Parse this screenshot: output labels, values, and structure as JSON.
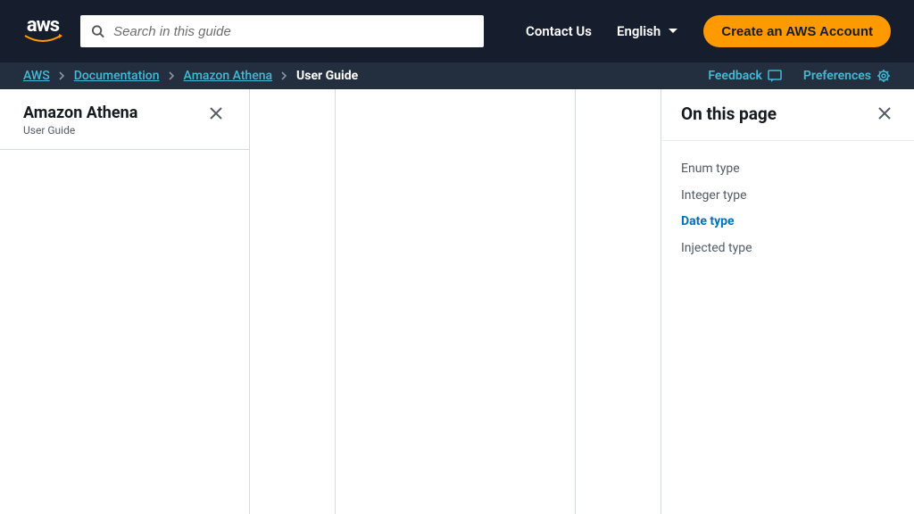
{
  "header": {
    "search_placeholder": "Search in this guide",
    "contact": "Contact Us",
    "language": "English",
    "create": "Create an AWS Account"
  },
  "breadcrumb": {
    "items": [
      "AWS",
      "Documentation",
      "Amazon Athena"
    ],
    "current": "User Guide",
    "feedback": "Feedback",
    "preferences": "Preferences"
  },
  "left": {
    "title": "Amazon Athena",
    "sub": "User Guide"
  },
  "right": {
    "title": "On this page",
    "items": [
      {
        "label": "Enum type",
        "active": false
      },
      {
        "label": "Integer type",
        "active": false
      },
      {
        "label": "Date type",
        "active": true
      },
      {
        "label": "Injected type",
        "active": false
      }
    ]
  }
}
